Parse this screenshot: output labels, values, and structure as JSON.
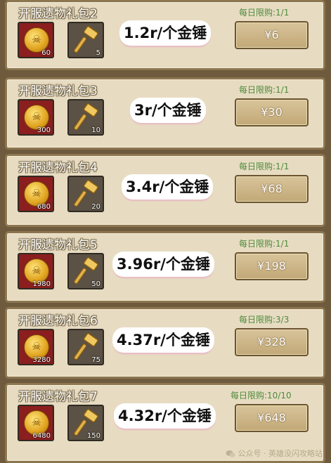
{
  "packs": [
    {
      "title": "开服遗物礼包2",
      "limit": "每日限购:1/1",
      "coin_qty": "60",
      "hammer_qty": "5",
      "price_note": "1.2r/个金锤",
      "price": "¥6"
    },
    {
      "title": "开服遗物礼包3",
      "limit": "每日限购:1/1",
      "coin_qty": "300",
      "hammer_qty": "10",
      "price_note": "3r/个金锤",
      "price": "¥30"
    },
    {
      "title": "开服遗物礼包4",
      "limit": "每日限购:1/1",
      "coin_qty": "680",
      "hammer_qty": "20",
      "price_note": "3.4r/个金锤",
      "price": "¥68"
    },
    {
      "title": "开服遗物礼包5",
      "limit": "每日限购:1/1",
      "coin_qty": "1980",
      "hammer_qty": "50",
      "price_note": "3.96r/个金锤",
      "price": "¥198"
    },
    {
      "title": "开服遗物礼包6",
      "limit": "每日限购:3/3",
      "coin_qty": "3280",
      "hammer_qty": "75",
      "price_note": "4.37r/个金锤",
      "price": "¥328"
    },
    {
      "title": "开服遗物礼包7",
      "limit": "每日限购:10/10",
      "coin_qty": "6480",
      "hammer_qty": "150",
      "price_note": "4.32r/个金锤",
      "price": "¥648"
    }
  ],
  "watermark": "公众号 · 英雄没闪攻略站",
  "colors": {
    "panel": "#e7dcc2",
    "border": "#8c7650",
    "limit_green": "#4f8a3c",
    "coin_slot": "#8b1e1e",
    "hammer_slot": "#5b5144",
    "button": "#c9b285"
  }
}
